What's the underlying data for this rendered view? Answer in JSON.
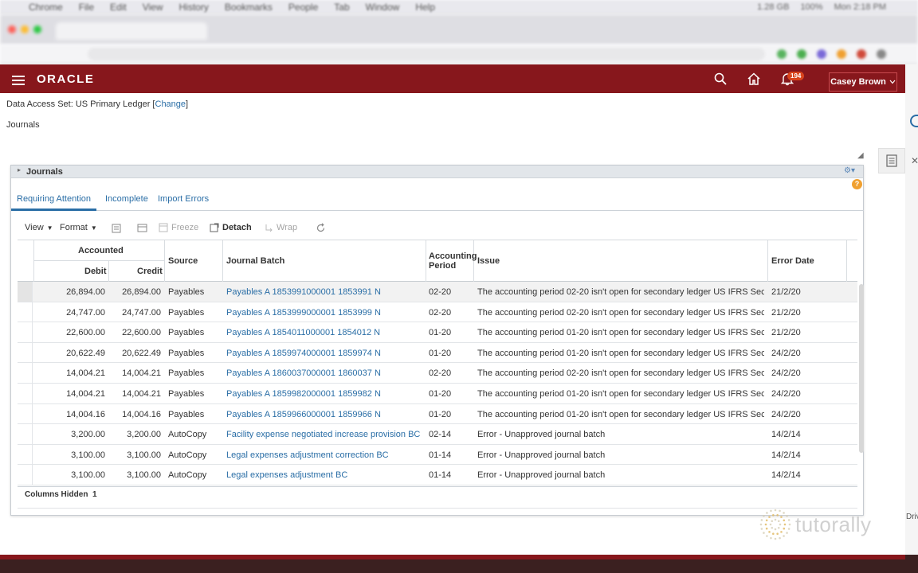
{
  "mac_menu": {
    "items": [
      "Chrome",
      "File",
      "Edit",
      "View",
      "History",
      "Bookmarks",
      "People",
      "Tab",
      "Window",
      "Help"
    ],
    "right": [
      "1.28 GB",
      "100%",
      "Mon 2:18 PM"
    ]
  },
  "header": {
    "logo": "ORACLE",
    "notifications_count": "194",
    "user_name": "Casey Brown"
  },
  "data_access": {
    "label": "Data Access Set:",
    "value": "US Primary Ledger",
    "change_link": "Change"
  },
  "page_title": "Journals",
  "panel": {
    "title": "Journals",
    "tabs": [
      "Requiring Attention",
      "Incomplete",
      "Import Errors"
    ],
    "active_tab": "Requiring Attention",
    "toolbar": {
      "view": "View",
      "format": "Format",
      "freeze": "Freeze",
      "detach": "Detach",
      "wrap": "Wrap"
    },
    "columns": {
      "accounted": "Accounted",
      "debit": "Debit",
      "credit": "Credit",
      "source": "Source",
      "journal_batch": "Journal Batch",
      "accounting_period_1": "Accounting",
      "accounting_period_2": "Period",
      "issue": "Issue",
      "error_date": "Error Date"
    },
    "rows": [
      {
        "debit": "26,894.00",
        "credit": "26,894.00",
        "source": "Payables",
        "batch": "Payables A 1853991000001 1853991 N",
        "period": "02-20",
        "issue": "The accounting period 02-20 isn't open for secondary ledger US IFRS Sec...",
        "date": "21/2/20"
      },
      {
        "debit": "24,747.00",
        "credit": "24,747.00",
        "source": "Payables",
        "batch": "Payables A 1853999000001 1853999 N",
        "period": "02-20",
        "issue": "The accounting period 02-20 isn't open for secondary ledger US IFRS Sec...",
        "date": "21/2/20"
      },
      {
        "debit": "22,600.00",
        "credit": "22,600.00",
        "source": "Payables",
        "batch": "Payables A 1854011000001 1854012 N",
        "period": "01-20",
        "issue": "The accounting period 01-20 isn't open for secondary ledger US IFRS Sec...",
        "date": "21/2/20"
      },
      {
        "debit": "20,622.49",
        "credit": "20,622.49",
        "source": "Payables",
        "batch": "Payables A 1859974000001 1859974 N",
        "period": "01-20",
        "issue": "The accounting period 01-20 isn't open for secondary ledger US IFRS Sec...",
        "date": "24/2/20"
      },
      {
        "debit": "14,004.21",
        "credit": "14,004.21",
        "source": "Payables",
        "batch": "Payables A 1860037000001 1860037 N",
        "period": "02-20",
        "issue": "The accounting period 02-20 isn't open for secondary ledger US IFRS Sec...",
        "date": "24/2/20"
      },
      {
        "debit": "14,004.21",
        "credit": "14,004.21",
        "source": "Payables",
        "batch": "Payables A 1859982000001 1859982 N",
        "period": "01-20",
        "issue": "The accounting period 01-20 isn't open for secondary ledger US IFRS Sec...",
        "date": "24/2/20"
      },
      {
        "debit": "14,004.16",
        "credit": "14,004.16",
        "source": "Payables",
        "batch": "Payables A 1859966000001 1859966 N",
        "period": "01-20",
        "issue": "The accounting period 01-20 isn't open for secondary ledger US IFRS Sec...",
        "date": "24/2/20"
      },
      {
        "debit": "3,200.00",
        "credit": "3,200.00",
        "source": "AutoCopy",
        "batch": "Facility expense negotiated increase provision BC",
        "period": "02-14",
        "issue": "Error - Unapproved journal batch",
        "date": "14/2/14"
      },
      {
        "debit": "3,100.00",
        "credit": "3,100.00",
        "source": "AutoCopy",
        "batch": "Legal expenses adjustment correction BC",
        "period": "01-14",
        "issue": "Error - Unapproved journal batch",
        "date": "14/2/14"
      },
      {
        "debit": "3,100.00",
        "credit": "3,100.00",
        "source": "AutoCopy",
        "batch": "Legal expenses adjustment BC",
        "period": "01-14",
        "issue": "Error - Unapproved journal batch",
        "date": "14/2/14"
      }
    ],
    "columns_hidden_label": "Columns Hidden",
    "columns_hidden_count": "1"
  },
  "watermark": "tutorally",
  "side": {
    "truncated_label": "Driv"
  },
  "colors": {
    "brand": "#87171c",
    "link": "#2a6ea6",
    "accent_badge": "#d8441c"
  }
}
